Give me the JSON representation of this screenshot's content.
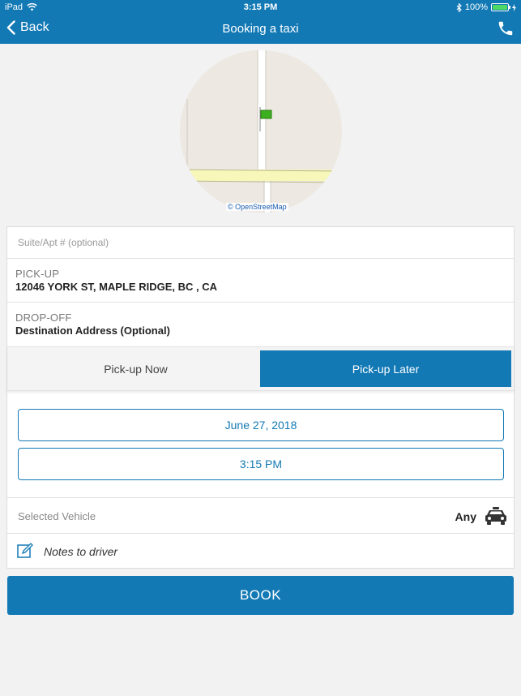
{
  "status_bar": {
    "device": "iPad",
    "time": "3:15 PM",
    "battery": "100%"
  },
  "nav": {
    "back_label": "Back",
    "title": "Booking a taxi"
  },
  "map": {
    "attribution": "© OpenStreetMap"
  },
  "form": {
    "suite_placeholder": "Suite/Apt # (optional)",
    "suite_value": "",
    "pickup_label": "PICK-UP",
    "pickup_value": "12046 YORK ST, MAPLE RIDGE, BC , CA",
    "dropoff_label": "DROP-OFF",
    "dropoff_value": "Destination Address (Optional)"
  },
  "pickup_mode": {
    "options": [
      "Pick-up Now",
      "Pick-up Later"
    ],
    "selected": "Pick-up Later"
  },
  "schedule": {
    "date": "June 27, 2018",
    "time": "3:15 PM"
  },
  "vehicle": {
    "label": "Selected Vehicle",
    "value": "Any"
  },
  "notes": {
    "label": "Notes to driver"
  },
  "book_label": "BOOK",
  "colors": {
    "brand": "#1279b5",
    "background": "#f2f2f2",
    "map_marker": "#3cb01e"
  }
}
